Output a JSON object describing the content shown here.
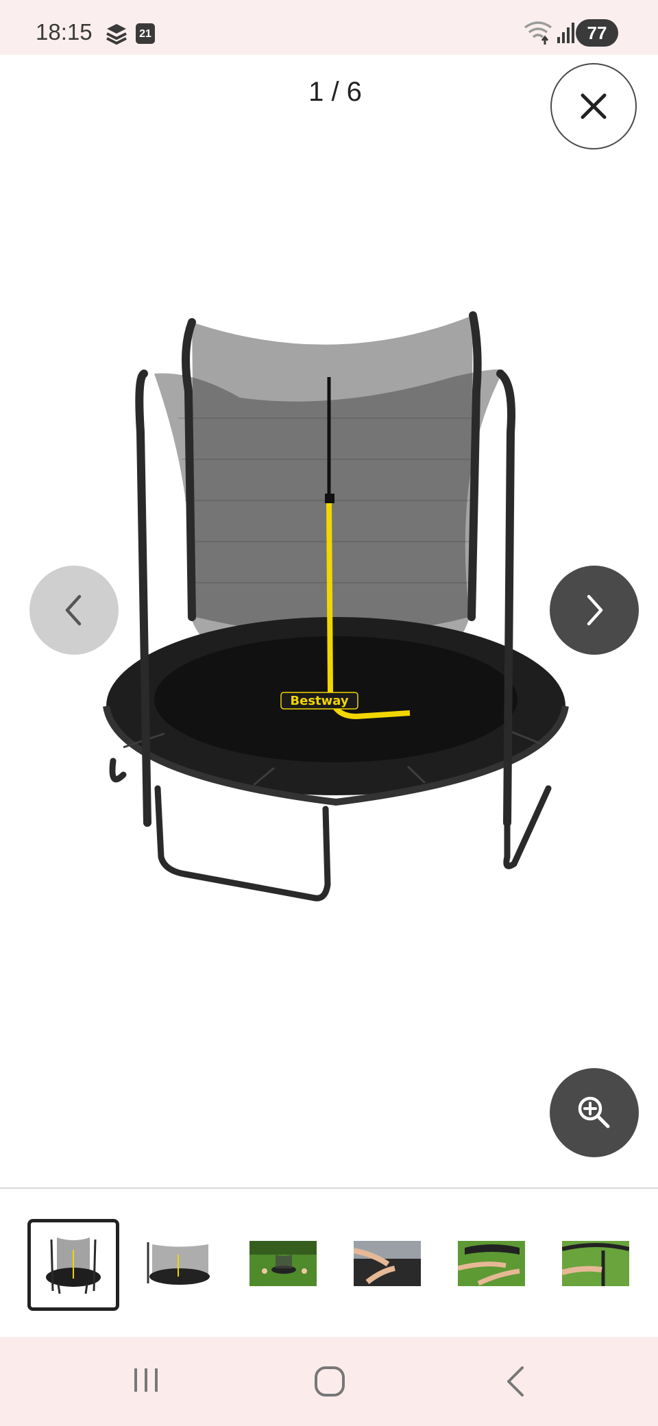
{
  "status_bar": {
    "time": "18:15",
    "calendar_day": "21",
    "battery": "77",
    "icons": [
      "cloud-stack-icon",
      "calendar-icon",
      "wifi-icon",
      "signal-icon",
      "battery-icon"
    ]
  },
  "viewer": {
    "counter": "1 / 6",
    "current_index": 1,
    "total": 6,
    "brand_on_image": "Bestway",
    "buttons": [
      "close-icon",
      "chevron-left-icon",
      "chevron-right-icon",
      "zoom-in-icon"
    ]
  },
  "thumbnails": [
    {
      "name": "trampoline-front",
      "selected": true
    },
    {
      "name": "trampoline-net-side",
      "selected": false
    },
    {
      "name": "trampoline-garden",
      "selected": false
    },
    {
      "name": "assembly-hands-1",
      "selected": false
    },
    {
      "name": "assembly-hands-2",
      "selected": false
    },
    {
      "name": "assembly-pole",
      "selected": false
    }
  ],
  "system_nav": [
    "recents-icon",
    "home-icon",
    "back-icon"
  ],
  "colors": {
    "status_bg": "#fbeeee",
    "nav_bg": "#fbeceb",
    "dark_button": "#4a4a4a",
    "light_button": "#cfcfcf",
    "accent_yellow": "#f2d600"
  }
}
